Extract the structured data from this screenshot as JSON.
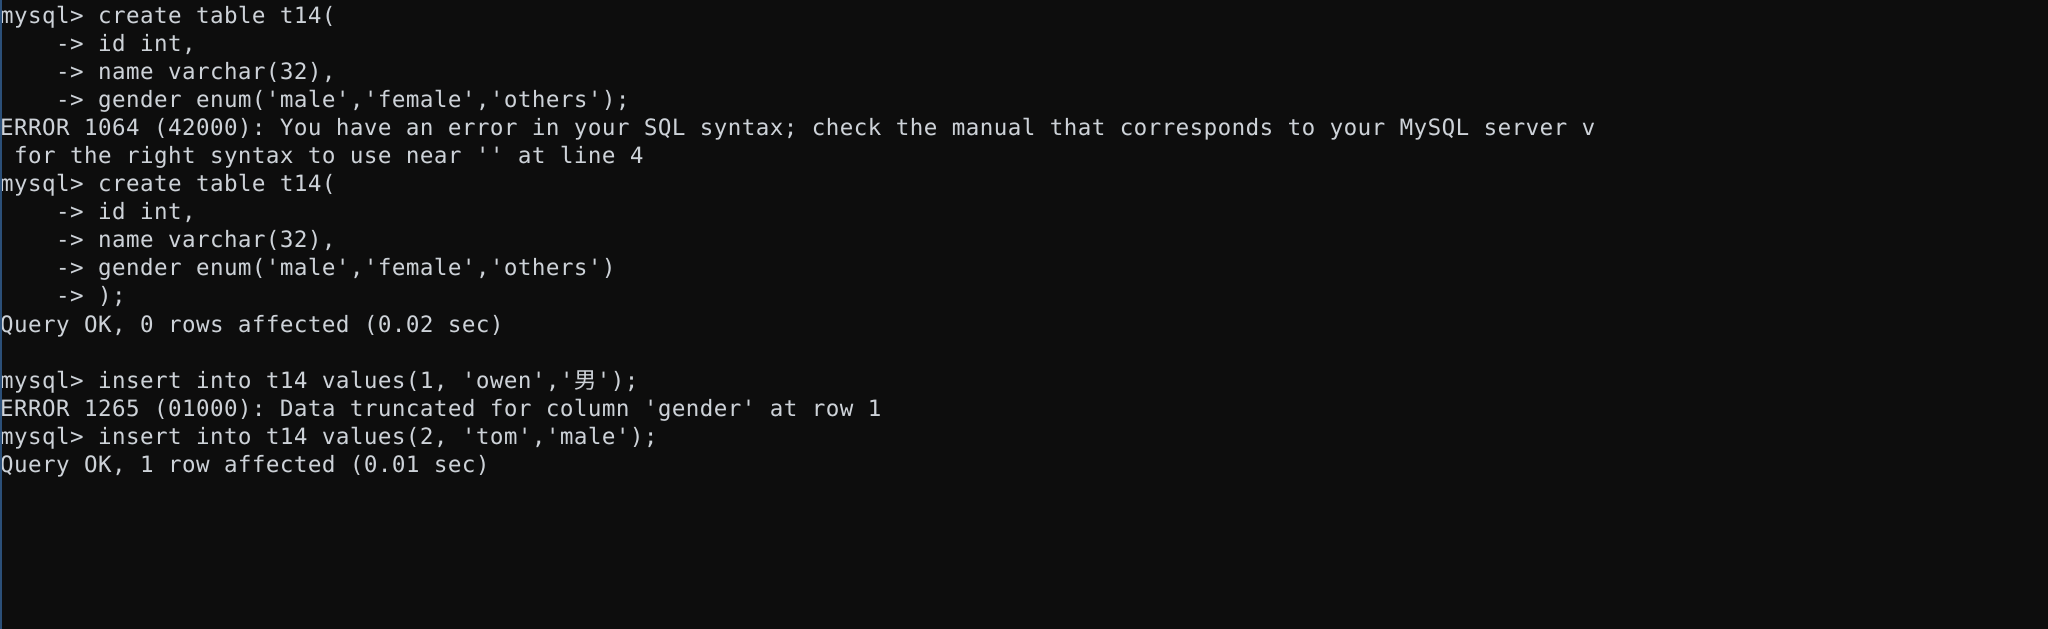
{
  "terminal": {
    "app": "mysql-client",
    "prompt": "mysql>",
    "continuation_prompt": "->",
    "colors": {
      "background": "#0d0d0d",
      "foreground": "#cdd2d8",
      "left_rule": "#2b4f78"
    },
    "lines": [
      "mysql> create table t14(",
      "    -> id int,",
      "    -> name varchar(32),",
      "    -> gender enum('male','female','others');",
      "ERROR 1064 (42000): You have an error in your SQL syntax; check the manual that corresponds to your MySQL server v",
      " for the right syntax to use near '' at line 4",
      "mysql> create table t14(",
      "    -> id int,",
      "    -> name varchar(32),",
      "    -> gender enum('male','female','others')",
      "    -> );",
      "Query OK, 0 rows affected (0.02 sec)",
      "",
      "mysql> insert into t14 values(1, 'owen','男');",
      "ERROR 1265 (01000): Data truncated for column 'gender' at row 1",
      "mysql> insert into t14 values(2, 'tom','male');",
      "Query OK, 1 row affected (0.01 sec)"
    ]
  }
}
